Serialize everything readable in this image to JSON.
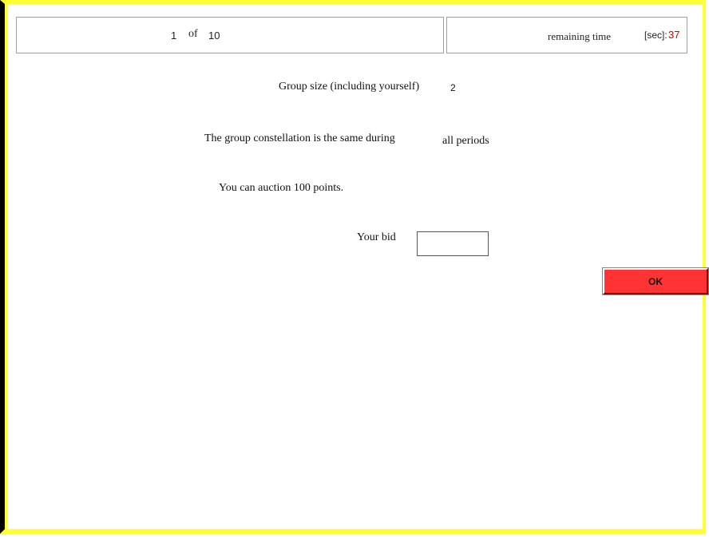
{
  "header": {
    "period_current": "1",
    "period_of": "of",
    "period_total": "10",
    "remaining_time_label": "remaining time",
    "remaining_time_unit": "[sec]:",
    "remaining_time_value": "37",
    "time_value_color": "#cc0000"
  },
  "main": {
    "group_size_label": "Group size (including yourself)",
    "group_size_value": "2",
    "constellation_text": "The group constellation is the same during",
    "constellation_text_end": "all periods",
    "auction_text": "You can auction 100 points.",
    "bid_label": "Your bid",
    "bid_value": ""
  },
  "actions": {
    "ok_label": "OK",
    "ok_color": "#ff3333"
  },
  "frame": {
    "border_color": "#ffff33"
  }
}
